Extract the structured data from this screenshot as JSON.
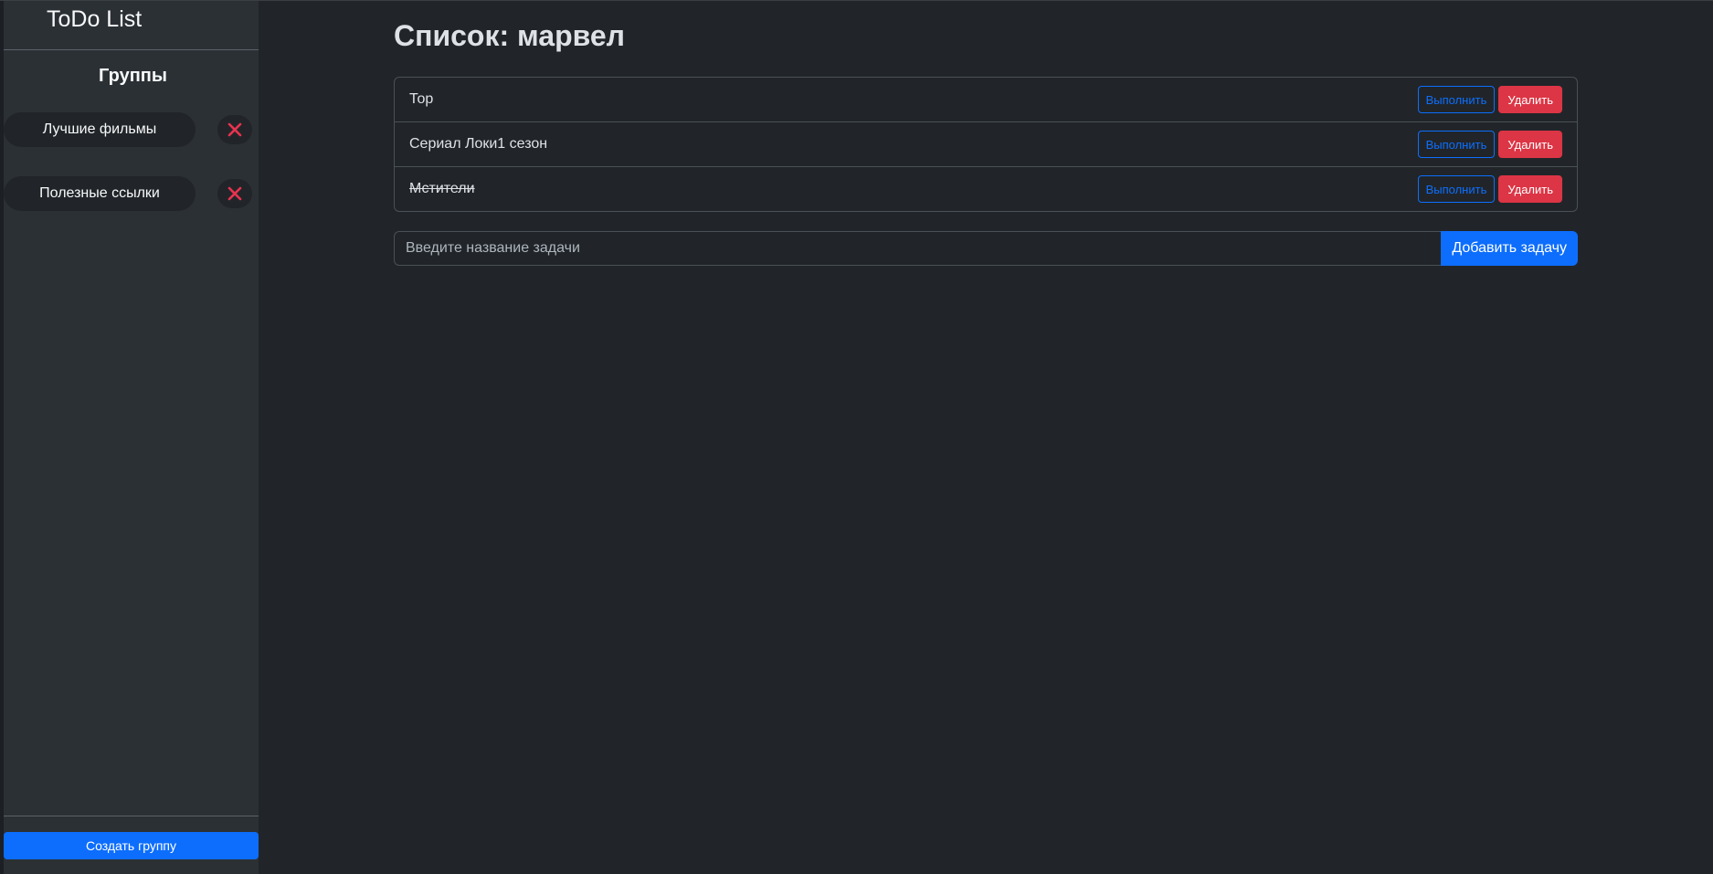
{
  "sidebar": {
    "brand": "ToDo List",
    "groups_heading": "Группы",
    "groups": [
      {
        "label": "Лучшие фильмы"
      },
      {
        "label": "Полезные ссылки"
      }
    ],
    "create_label": "Создать группу"
  },
  "main": {
    "title": "Список: марвел",
    "tasks": [
      {
        "text": "Тор",
        "done": false,
        "complete_label": "Выполнить",
        "delete_label": "Удалить"
      },
      {
        "text": "Сериал Локи1 сезон",
        "done": false,
        "complete_label": "Выполнить",
        "delete_label": "Удалить"
      },
      {
        "text": "Мстители",
        "done": true,
        "complete_label": "Выполнить",
        "delete_label": "Удалить"
      }
    ],
    "add_placeholder": "Введите название задачи",
    "add_value": "",
    "add_button_label": "Добавить задачу"
  },
  "colors": {
    "accent": "#0d6efd",
    "danger": "#dc3545",
    "background": "#212529",
    "sidebar": "#2b3035"
  },
  "icons": {
    "group_delete": "close-x-icon"
  }
}
